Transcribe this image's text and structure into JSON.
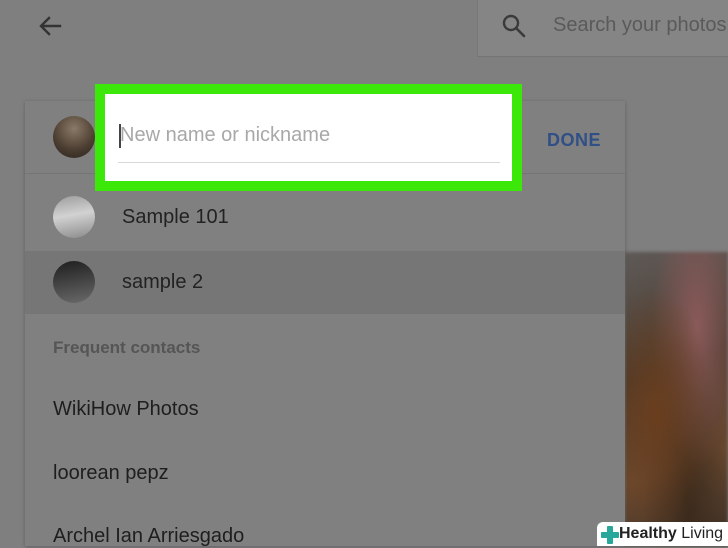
{
  "topbar": {
    "back_icon": "arrow-left-icon",
    "search_icon": "search-icon",
    "search_placeholder": "Search your photos"
  },
  "panel": {
    "input_placeholder": "New name or nickname",
    "done_label": "DONE",
    "suggestions": [
      {
        "name": "Sample 101"
      },
      {
        "name": "sample 2"
      }
    ],
    "frequent_label": "Frequent contacts",
    "contacts": [
      {
        "name": "WikiHow Photos"
      },
      {
        "name": "loorean pepz"
      },
      {
        "name": "Archel Ian Arriesgado"
      }
    ]
  },
  "highlight_color": "#3be80a",
  "accent_color": "#2f4f86",
  "watermark": {
    "word1": "Healthy",
    "word2": "Living",
    "cross_color": "#2aa79b"
  }
}
